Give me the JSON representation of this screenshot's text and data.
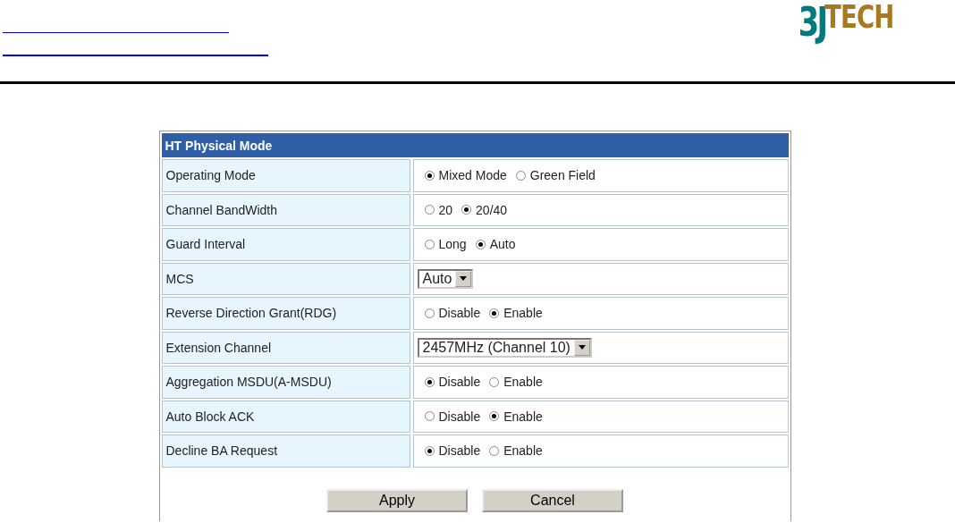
{
  "logo": {
    "part_1": "3J",
    "part_2": "TECH"
  },
  "panel": {
    "title": "HT Physical Mode",
    "rows": [
      {
        "label": "Operating Mode",
        "kind": "radio",
        "options": [
          {
            "label": "Mixed Mode",
            "selected": true
          },
          {
            "label": "Green Field",
            "selected": false
          }
        ]
      },
      {
        "label": "Channel BandWidth",
        "kind": "radio",
        "options": [
          {
            "label": "20",
            "selected": false
          },
          {
            "label": "20/40",
            "selected": true
          }
        ]
      },
      {
        "label": "Guard Interval",
        "kind": "radio",
        "options": [
          {
            "label": "Long",
            "selected": false
          },
          {
            "label": "Auto",
            "selected": true
          }
        ]
      },
      {
        "label": "MCS",
        "kind": "select",
        "value": "Auto"
      },
      {
        "label": "Reverse Direction Grant(RDG)",
        "kind": "radio",
        "options": [
          {
            "label": "Disable",
            "selected": false
          },
          {
            "label": "Enable",
            "selected": true
          }
        ]
      },
      {
        "label": "Extension Channel",
        "kind": "select",
        "value": "2457MHz (Channel 10)"
      },
      {
        "label": "Aggregation MSDU(A-MSDU)",
        "kind": "radio",
        "options": [
          {
            "label": "Disable",
            "selected": true
          },
          {
            "label": "Enable",
            "selected": false
          }
        ]
      },
      {
        "label": "Auto Block ACK",
        "kind": "radio",
        "options": [
          {
            "label": "Disable",
            "selected": false
          },
          {
            "label": "Enable",
            "selected": true
          }
        ]
      },
      {
        "label": "Decline BA Request",
        "kind": "radio",
        "options": [
          {
            "label": "Disable",
            "selected": true
          },
          {
            "label": "Enable",
            "selected": false
          }
        ]
      }
    ],
    "buttons": [
      "Apply",
      "Cancel"
    ]
  }
}
